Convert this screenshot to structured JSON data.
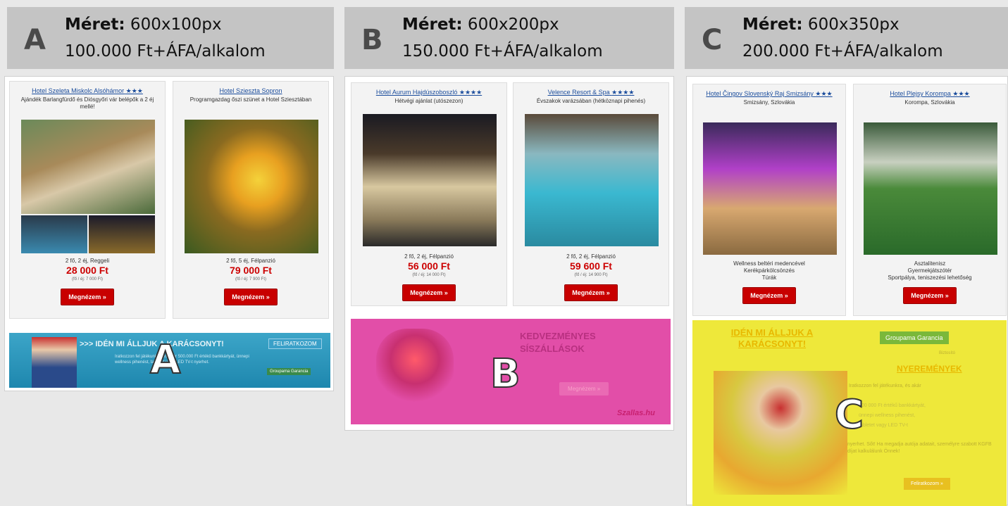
{
  "columns": [
    {
      "letter": "A",
      "size_label": "Méret:",
      "size_value": " 600x100px",
      "price": "100.000 Ft+ÁFA/alkalom",
      "overlay_letter": "A",
      "cards": [
        {
          "name": "Hotel Szeleta Miskolc Alsóhámor",
          "stars": "★★★",
          "sub": "Ajándék Barlangfürdő és Diósgyőri vár belépők a 2 éj mellé!",
          "detail": "2 fő, 2 éj, Reggeli",
          "price": "28 000 Ft",
          "small": "(fő / éj: 7 000 Ft)",
          "button": "Megnézem »"
        },
        {
          "name": "Hotel Szieszta Sopron",
          "stars": "",
          "sub": "Programgazdag őszi szünet a Hotel Sziesztában",
          "detail": "2 fő, 5 éj, Félpanzió",
          "price": "79 000 Ft",
          "small": "(fő / éj: 7 900 Ft)",
          "button": "Megnézem »"
        }
      ],
      "banner": {
        "headline": ">>> IDÉN MI ÁLLJUK A KARÁCSONYT!",
        "cta": "FELIRATKOZOM",
        "body": "Iratkozzon fel játékunkra, és akár 500.000 Ft értékű bankkártyát, ünnepi wellness pihenést, tabletet vagy LED TV-t nyerhet.",
        "brand": "Groupama Garancia"
      }
    },
    {
      "letter": "B",
      "size_label": "Méret:",
      "size_value": " 600x200px",
      "price": "150.000 Ft+ÁFA/alkalom",
      "overlay_letter": "B",
      "cards": [
        {
          "name": "Hotel Aurum Hajdúszoboszló",
          "stars": "★★★★",
          "sub": "Hétvégi ajánlat (utószezon)",
          "detail": "2 fő, 2 éj, Félpanzió",
          "price": "56 000 Ft",
          "small": "(fő / éj: 14 000 Ft)",
          "button": "Megnézem »"
        },
        {
          "name": "Velence Resort & Spa",
          "stars": "★★★★",
          "sub": "Évszakok varázsában (hétköznapi pihenés)",
          "detail": "2 fő, 2 éj, Félpanzió",
          "price": "59 600 Ft",
          "small": "(fő / éj: 14 900 Ft)",
          "button": "Megnézem »"
        }
      ],
      "banner": {
        "headline": "KEDVEZMÉNYES SÍSZÁLLÁSOK",
        "cta": "Megnézem »",
        "brand": "Szallas.hu"
      }
    },
    {
      "letter": "C",
      "size_label": "Méret:",
      "size_value": " 600x350px",
      "price": "200.000 Ft+ÁFA/alkalom",
      "overlay_letter": "C",
      "cards": [
        {
          "name": "Hotel Čingov Slovenský Raj Smizsány",
          "stars": "★★★",
          "sub": "Smizsány, Szlovákia",
          "detail": "Wellness beltéri medencével\nKerékpárkölcsönzés\nTúrák",
          "price": "",
          "small": "",
          "button": "Megnézem »"
        },
        {
          "name": "Hotel Plejsy Korompa",
          "stars": "★★★",
          "sub": "Korompa, Szlovákia",
          "detail": "Asztalitenisz\nGyermekjátszótér\nSportpálya, teniszezési lehetőség",
          "price": "",
          "small": "",
          "button": "Megnézem »"
        }
      ],
      "banner": {
        "headline": "IDÉN MI ÁLLJUK A KARÁCSONYT!",
        "brand": "Groupama Garancia",
        "brand_sub": "Biztosító",
        "prizes_title": "NYEREMÉNYEK",
        "line1": "Iratkozzon fel játékunkra, és akár",
        "line2": "500 000 Ft értékű bankkártyát,",
        "line3": "ünnepi wellness pihenést,",
        "line4": "tabletet vagy LED TV-t",
        "line5": "nyerhet. Sőt! Ha megadja autója adatait, személyre szabott KGFB díjat kalkulálunk Önnek!",
        "cta": "Feliratkozom »"
      }
    }
  ],
  "colors": {
    "header_bg": "#c4c4c4",
    "price_red": "#cc0000",
    "link_blue": "#1a4c9c",
    "banner_a": "#2a9ac0",
    "banner_b": "#e24ea8",
    "banner_c": "#eee83a"
  }
}
